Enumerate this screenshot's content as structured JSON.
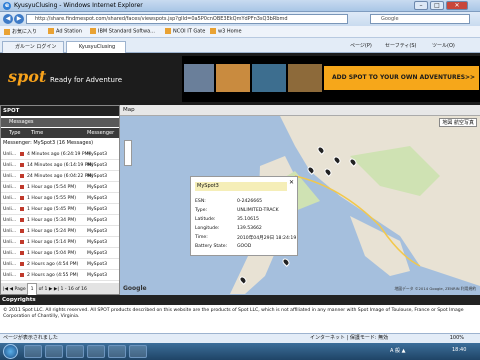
{
  "window": {
    "title": "KyusyuClusing - Windows Internet Explorer",
    "min": "–",
    "max": "□",
    "close": "✕"
  },
  "address": {
    "url": "http://share.findmespot.com/shared/faces/viewspots.jsp?glId=0a5P0cnOBE3EkQmYdPFn3sQ3bRbmd",
    "search_placeholder": "Google"
  },
  "favorites": {
    "items": [
      "お気に入り",
      "Ad Station",
      "IBM Standard Softwa...",
      "NCOI IT Gate",
      "w3 Home"
    ]
  },
  "tabs": [
    {
      "label": "ガルーン ログイン"
    },
    {
      "label": "KyusyuClusing"
    }
  ],
  "commands": [
    "ページ(P)",
    "セーフティ(S)",
    "ツール(O)"
  ],
  "banner": {
    "logo_main": "sp",
    "logo_accent": "ot",
    "tagline": "Ready for Adventure",
    "ad_text": "ADD SPOT TO YOUR OWN ADVENTURES>>"
  },
  "panel": {
    "title": "SPOT",
    "messages_label": "Messages",
    "col_type": "Type",
    "col_time": "Time",
    "col_messenger": "Messenger",
    "group_label": "Messenger: MySpot3 (16 Messages)",
    "rows": [
      {
        "type": "Unli...",
        "time": "4 Minutes ago (6:24:19 PM)",
        "messenger": "MySpot3"
      },
      {
        "type": "Unli...",
        "time": "14 Minutes ago (6:14:19 PM)",
        "messenger": "MySpot3"
      },
      {
        "type": "Unli...",
        "time": "24 Minutes ago (6:04:22 PM)",
        "messenger": "MySpot3"
      },
      {
        "type": "Unli...",
        "time": "1 Hour ago (5:54 PM)",
        "messenger": "MySpot3"
      },
      {
        "type": "Unli...",
        "time": "1 Hour ago (5:55 PM)",
        "messenger": "MySpot3"
      },
      {
        "type": "Unli...",
        "time": "1 Hour ago (5:45 PM)",
        "messenger": "MySpot3"
      },
      {
        "type": "Unli...",
        "time": "1 Hour ago (5:34 PM)",
        "messenger": "MySpot3"
      },
      {
        "type": "Unli...",
        "time": "1 Hour ago (5:24 PM)",
        "messenger": "MySpot3"
      },
      {
        "type": "Unli...",
        "time": "1 Hour ago (5:14 PM)",
        "messenger": "MySpot3"
      },
      {
        "type": "Unli...",
        "time": "1 Hour ago (5:04 PM)",
        "messenger": "MySpot3"
      },
      {
        "type": "Unli...",
        "time": "2 Hours ago (4:54 PM)",
        "messenger": "MySpot3"
      },
      {
        "type": "Unli...",
        "time": "2 Hours ago (4:55 PM)",
        "messenger": "MySpot3"
      }
    ],
    "pager": {
      "page_label": "Page",
      "page_value": "1",
      "of": "of 1",
      "range": "1 - 16 of 16"
    }
  },
  "map": {
    "tab_label": "Map",
    "type_label": "地図 航空写真",
    "popup": {
      "title": "MySpot3",
      "rows": [
        {
          "label": "ESN:",
          "value": "0-2426665"
        },
        {
          "label": "Type:",
          "value": "UNLIMITED-TRACK"
        },
        {
          "label": "Latitude:",
          "value": "35.10615"
        },
        {
          "label": "Longitude:",
          "value": "139.53662"
        },
        {
          "label": "Time:",
          "value": "2010年04月29日 18:24:19"
        },
        {
          "label": "Battery State:",
          "value": "GOOD"
        }
      ],
      "close": "✕"
    },
    "google": "Google",
    "terms": "地図データ ©2014 Google, ZENRIN 利用規約"
  },
  "copyright": {
    "title": "Copyrights",
    "text": "© 2011 Spot LLC. All rights reserved. All SPOT products described on this website are the products of Spot LLC, which is not affiliated in any manner with Spot Image of Toulouse, France or Spot Image Corporation of Chantilly, Virginia."
  },
  "status": {
    "left": "ページが表示されました",
    "zone": "インターネット | 保護モード: 無効",
    "zoom": "100%"
  },
  "taskbar": {
    "tray": "A 般 ▲",
    "clock": "18:40"
  }
}
